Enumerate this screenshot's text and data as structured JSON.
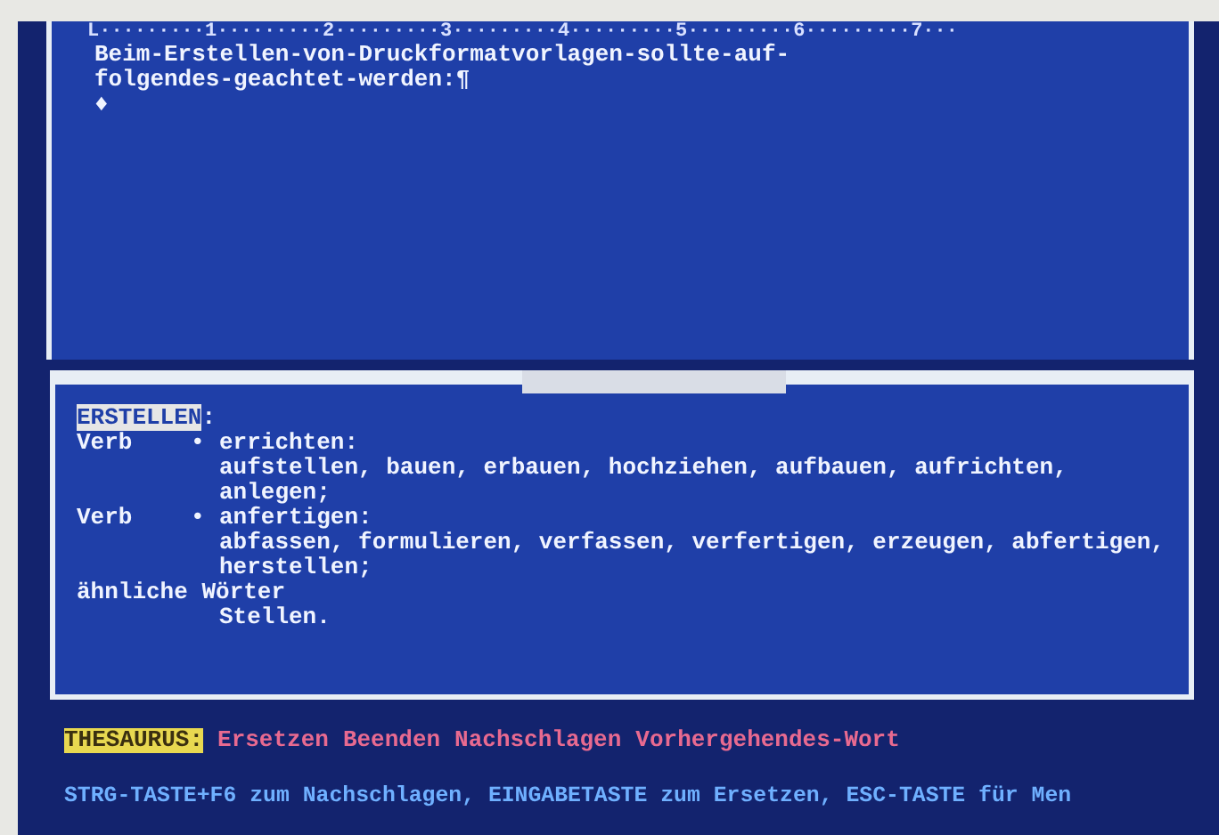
{
  "editor": {
    "ruler": "L·········1·········2·········3·········4·········5·········6·········7···",
    "lines": [
      "Beim-Erstellen-von-Druckformatvorlagen-sollte-auf-",
      "folgendes-geachtet-werden:¶"
    ],
    "end_mark": "♦"
  },
  "thesaurus": {
    "headword": {
      "text": "ERSTELLEN",
      "punctuation": ":",
      "selected": true
    },
    "senses": [
      {
        "part_of_speech": "Verb",
        "bullet": "•",
        "meaning": "errichten:",
        "synonyms": "aufstellen, bauen, erbauen, hochziehen, aufbauen, aufrichten, anlegen;"
      },
      {
        "part_of_speech": "Verb",
        "bullet": "•",
        "meaning": "anfertigen:",
        "synonyms": "abfassen, formulieren, verfassen, verfertigen, erzeugen, abfertigen, herstellen;"
      }
    ],
    "related": {
      "label": "ähnliche Wörter",
      "words": "Stellen."
    }
  },
  "command_menu": {
    "label": "THESAURUS:",
    "commands": [
      "Ersetzen",
      "Beenden",
      "Nachschlagen",
      "Vorhergehendes-Wort"
    ]
  },
  "message": "STRG-TASTE+F6 zum Nachschlagen, EINGABETASTE zum Ersetzen, ESC-TASTE für Men"
}
